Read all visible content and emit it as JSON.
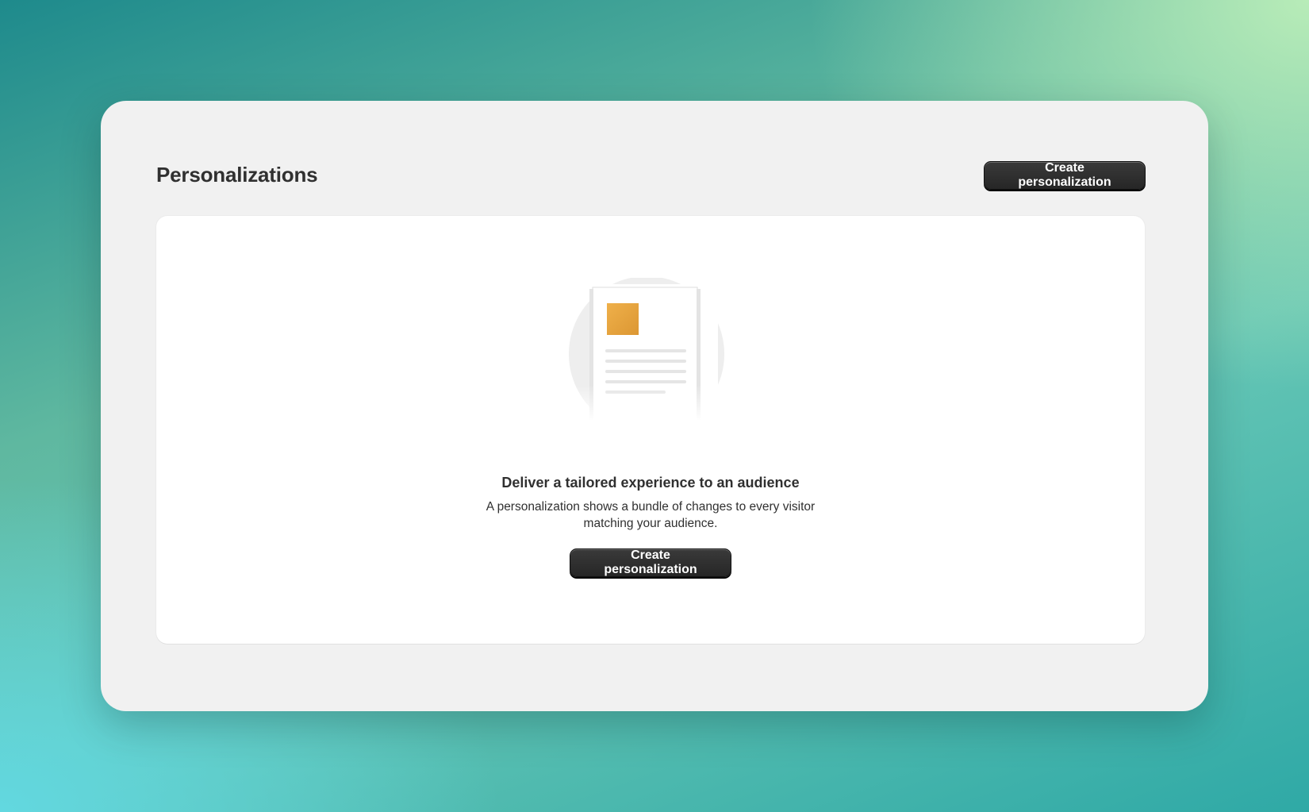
{
  "page": {
    "title": "Personalizations",
    "create_button_label": "Create personalization"
  },
  "empty_state": {
    "illustration_icon": "document-icon",
    "heading": "Deliver a tailored experience to an audience",
    "description": "A personalization shows a bundle of changes to every visitor matching your audience.",
    "create_button_label": "Create personalization"
  },
  "colors": {
    "primary_button": "#303030",
    "accent_square": "#e5a23a",
    "page_background": "#f1f1f1",
    "card_background": "#ffffff"
  }
}
